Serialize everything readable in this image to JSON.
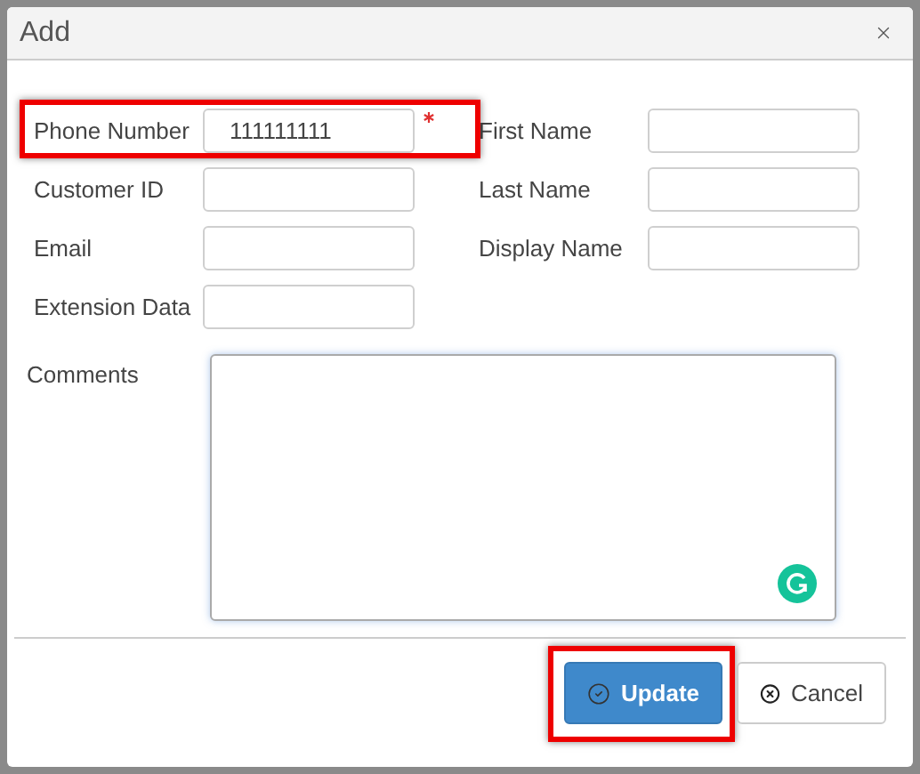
{
  "dialog": {
    "title": "Add"
  },
  "left_fields": [
    {
      "label": "Phone Number",
      "value": "111111111",
      "required": true,
      "highlighted": true
    },
    {
      "label": "Customer ID",
      "required": false,
      "highlighted": false
    },
    {
      "label": "Email",
      "required": false,
      "highlighted": false
    },
    {
      "label": "Extension Data",
      "required": false,
      "highlighted": false
    }
  ],
  "right_fields": [
    {
      "label": "First Name"
    },
    {
      "label": "Last Name"
    },
    {
      "label": "Display Name"
    }
  ],
  "comments": {
    "label": "Comments"
  },
  "buttons": [
    {
      "label": "Update",
      "kind": "primary",
      "highlighted": true
    },
    {
      "label": "Cancel",
      "kind": "secondary",
      "highlighted": false
    }
  ]
}
